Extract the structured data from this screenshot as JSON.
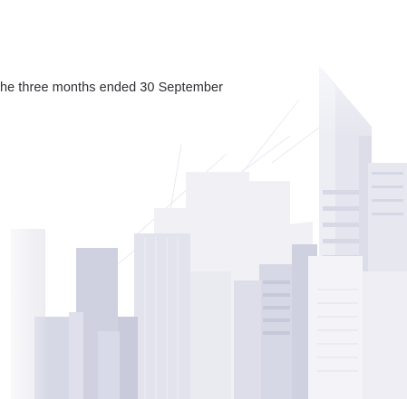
{
  "document": {
    "subtitle": "he three months ended 30 September"
  },
  "colors": {
    "background": "#ffffff",
    "text": "#2f2f35",
    "building_light": "#ebebf2",
    "building_mid": "#d9dae6",
    "building_dark": "#c6c8da"
  }
}
